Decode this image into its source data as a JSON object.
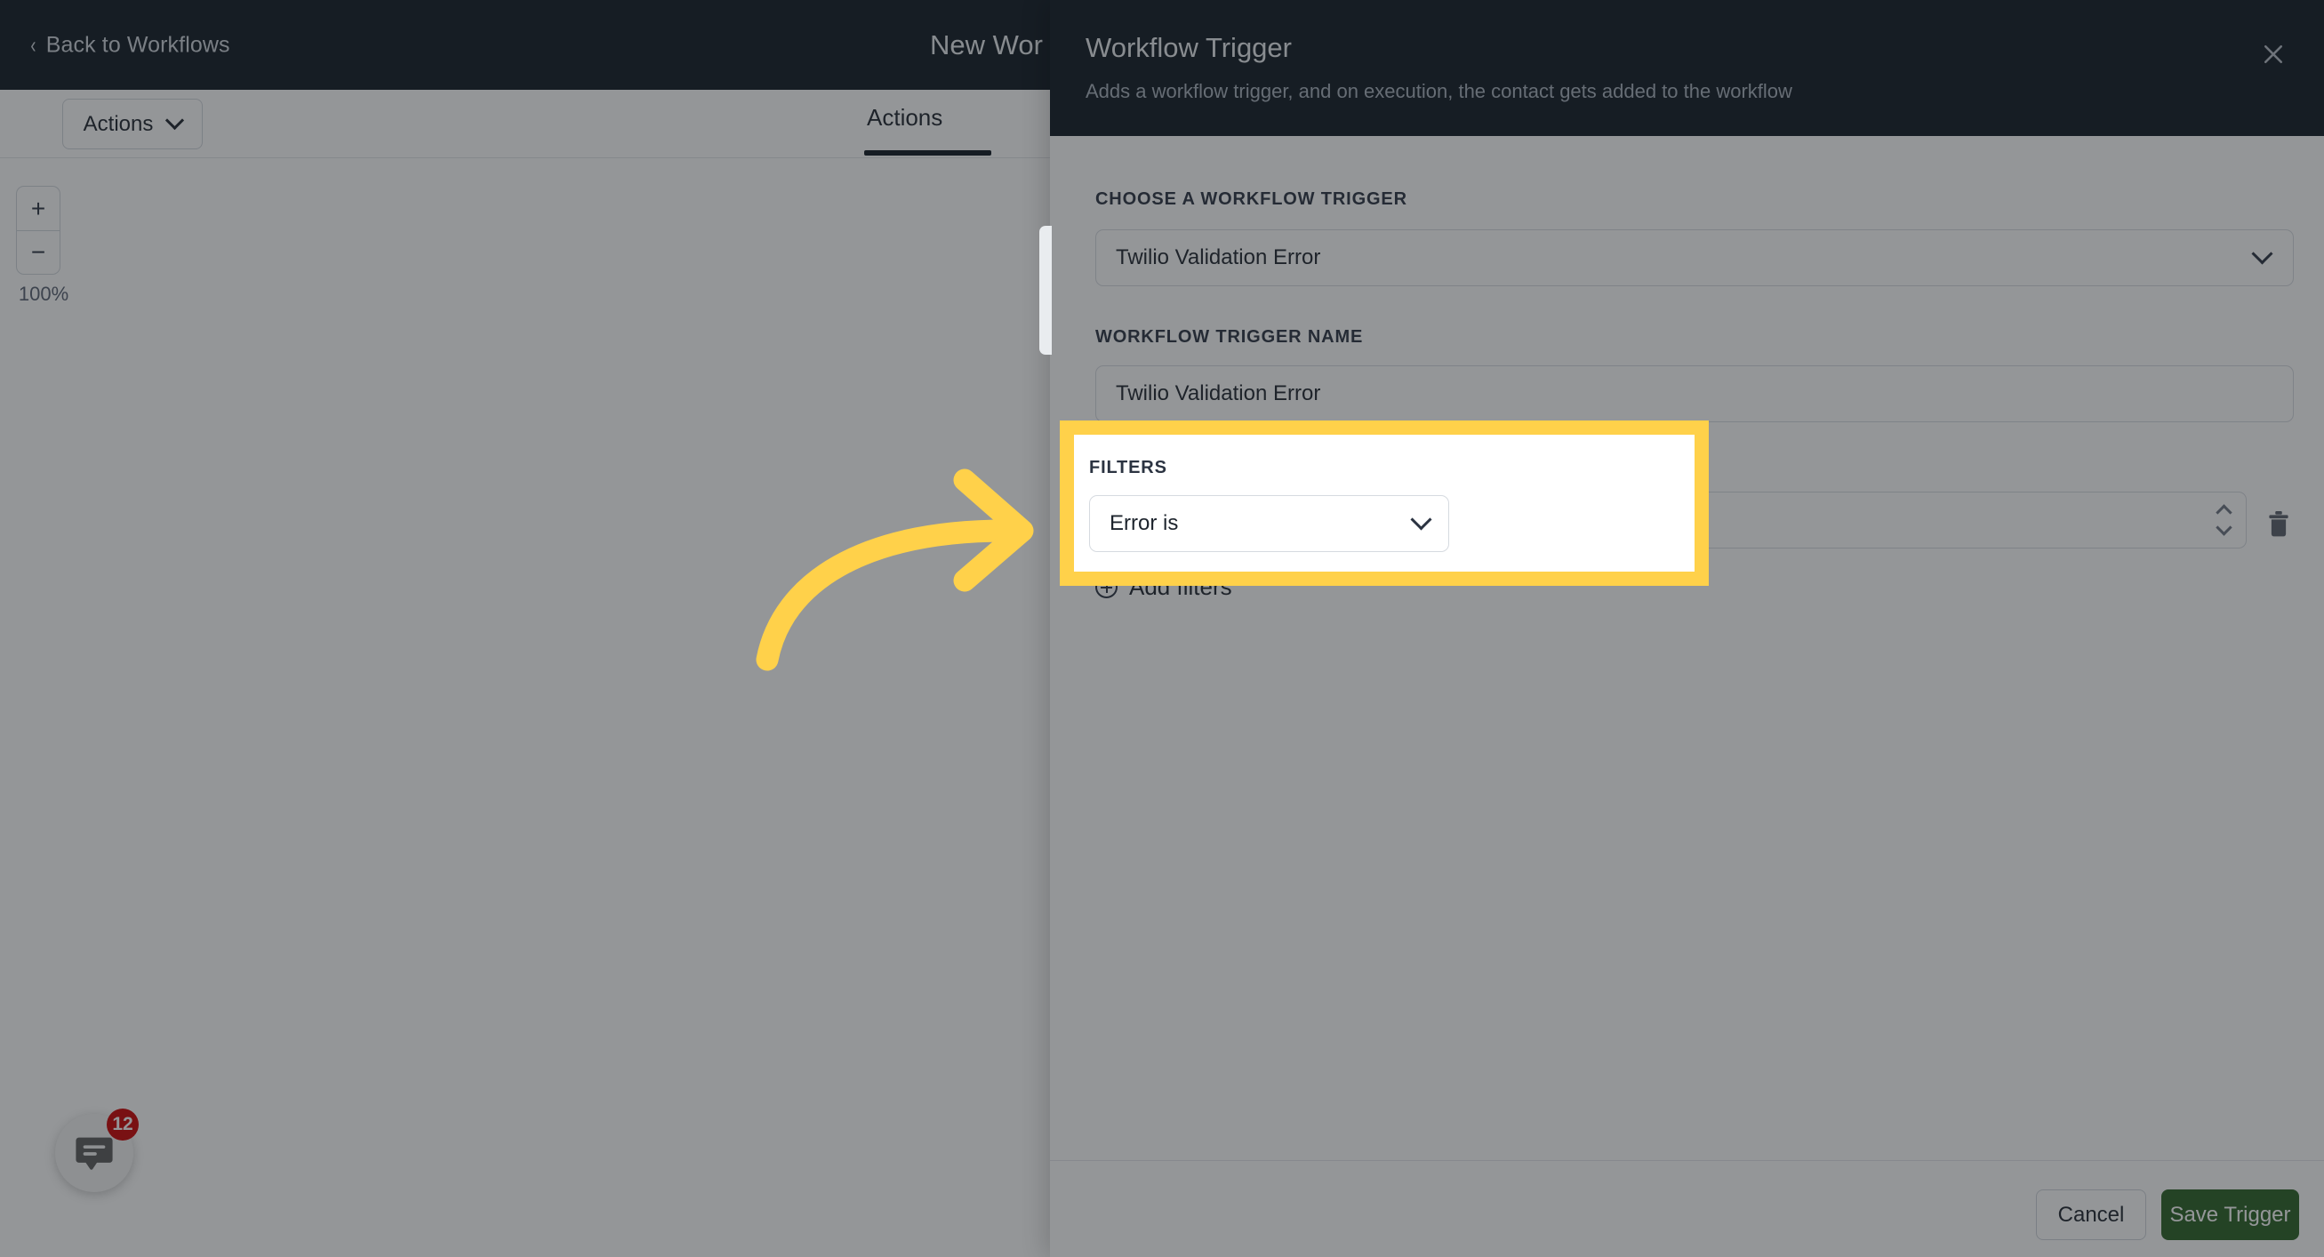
{
  "topbar": {
    "back_label": "Back to Workflows",
    "back_icon": "chevron-left-icon",
    "workflow_title": "New Wor"
  },
  "toolbar": {
    "actions_dropdown_label": "Actions",
    "actions_dropdown_icon": "chevron-down-icon",
    "active_tab_label": "Actions"
  },
  "canvas": {
    "zoom_in_label": "+",
    "zoom_out_label": "−",
    "zoom_level": "100%",
    "chat_badge_count": "12",
    "chat_icon": "chat-bubble-icon"
  },
  "panel": {
    "title": "Workflow Trigger",
    "subtitle": "Adds a workflow trigger, and on execution, the contact gets added to the workflow",
    "close_icon": "close-icon",
    "fields": {
      "choose_trigger_label": "CHOOSE A WORKFLOW TRIGGER",
      "choose_trigger_value": "Twilio Validation Error",
      "choose_trigger_icon": "chevron-down-icon",
      "trigger_name_label": "WORKFLOW TRIGGER NAME",
      "trigger_name_value": "Twilio Validation Error",
      "filters_label": "FILTERS",
      "filter_field_value": "Error is",
      "filter_field_icon": "chevron-down-icon",
      "filter_value_value": "",
      "filter_value_icon": "stepper-icon",
      "filter_delete_icon": "trash-icon",
      "add_filters_label": "Add filters",
      "add_filters_icon": "plus-circle-icon"
    },
    "footer": {
      "cancel_label": "Cancel",
      "save_label": "Save Trigger"
    }
  },
  "annotation": {
    "highlight_color": "#FFD14A",
    "arrow_color": "#FFD14A",
    "arrow_icon": "curved-arrow-right-icon"
  },
  "colors": {
    "header_dark": "#0f1821",
    "save_green": "#2a6024",
    "badge_red": "#cc0000",
    "accent_yellow": "#FFD14A"
  }
}
